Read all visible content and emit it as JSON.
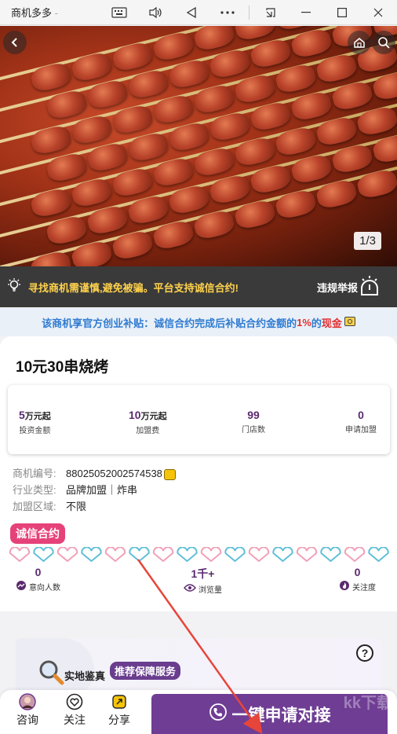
{
  "window": {
    "title": "商机多多",
    "title_fade": " - ",
    "icons": [
      "keyboard-icon",
      "speaker-icon",
      "back-triangle-icon",
      "more-icon",
      "snap-icon",
      "minimize-icon",
      "maximize-icon",
      "close-icon"
    ]
  },
  "hero": {
    "counter": "1/3"
  },
  "warning": {
    "text": "寻找商机需谨慎,避免被骗。平台支持诚信合约!",
    "report": "违规举报"
  },
  "subsidy": {
    "prefix": "该商机享官方创业补贴：诚信合约完成后补贴合约金额的",
    "percent": "1%",
    "mid": "的",
    "cash": "现金"
  },
  "listing": {
    "title": "10元30串烧烤",
    "stats": [
      {
        "value": "5",
        "unit": "万元起",
        "label": "投资金额"
      },
      {
        "value": "10",
        "unit": "万元起",
        "label": "加盟费"
      },
      {
        "value": "99",
        "unit": "",
        "label": "门店数"
      },
      {
        "value": "0",
        "unit": "",
        "label": "申请加盟"
      }
    ],
    "info": [
      {
        "key": "商机编号:",
        "value": "88025052002574538"
      },
      {
        "key": "行业类型:",
        "value": "品牌加盟｜炸串"
      },
      {
        "key": "加盟区域:",
        "value": "不限"
      }
    ],
    "badge": "诚信合约",
    "metrics": [
      {
        "value": "0",
        "label": "意向人数"
      },
      {
        "value": "1千+",
        "label": "浏览量"
      },
      {
        "value": "0",
        "label": "关注度"
      }
    ]
  },
  "service": {
    "label": "实地鉴真",
    "tag": "推荐保障服务",
    "help": "?"
  },
  "bottom": {
    "consult": "咨询",
    "follow": "关注",
    "share": "分享",
    "apply": "一键申请对接"
  },
  "watermark": "kk下载",
  "colors": {
    "accent_purple": "#6f3d94",
    "badge_pink": "#e6427a",
    "warning_yellow": "#ffd24c",
    "subsidy_blue": "#2f7bd0",
    "arrow_red": "#e8453a"
  }
}
